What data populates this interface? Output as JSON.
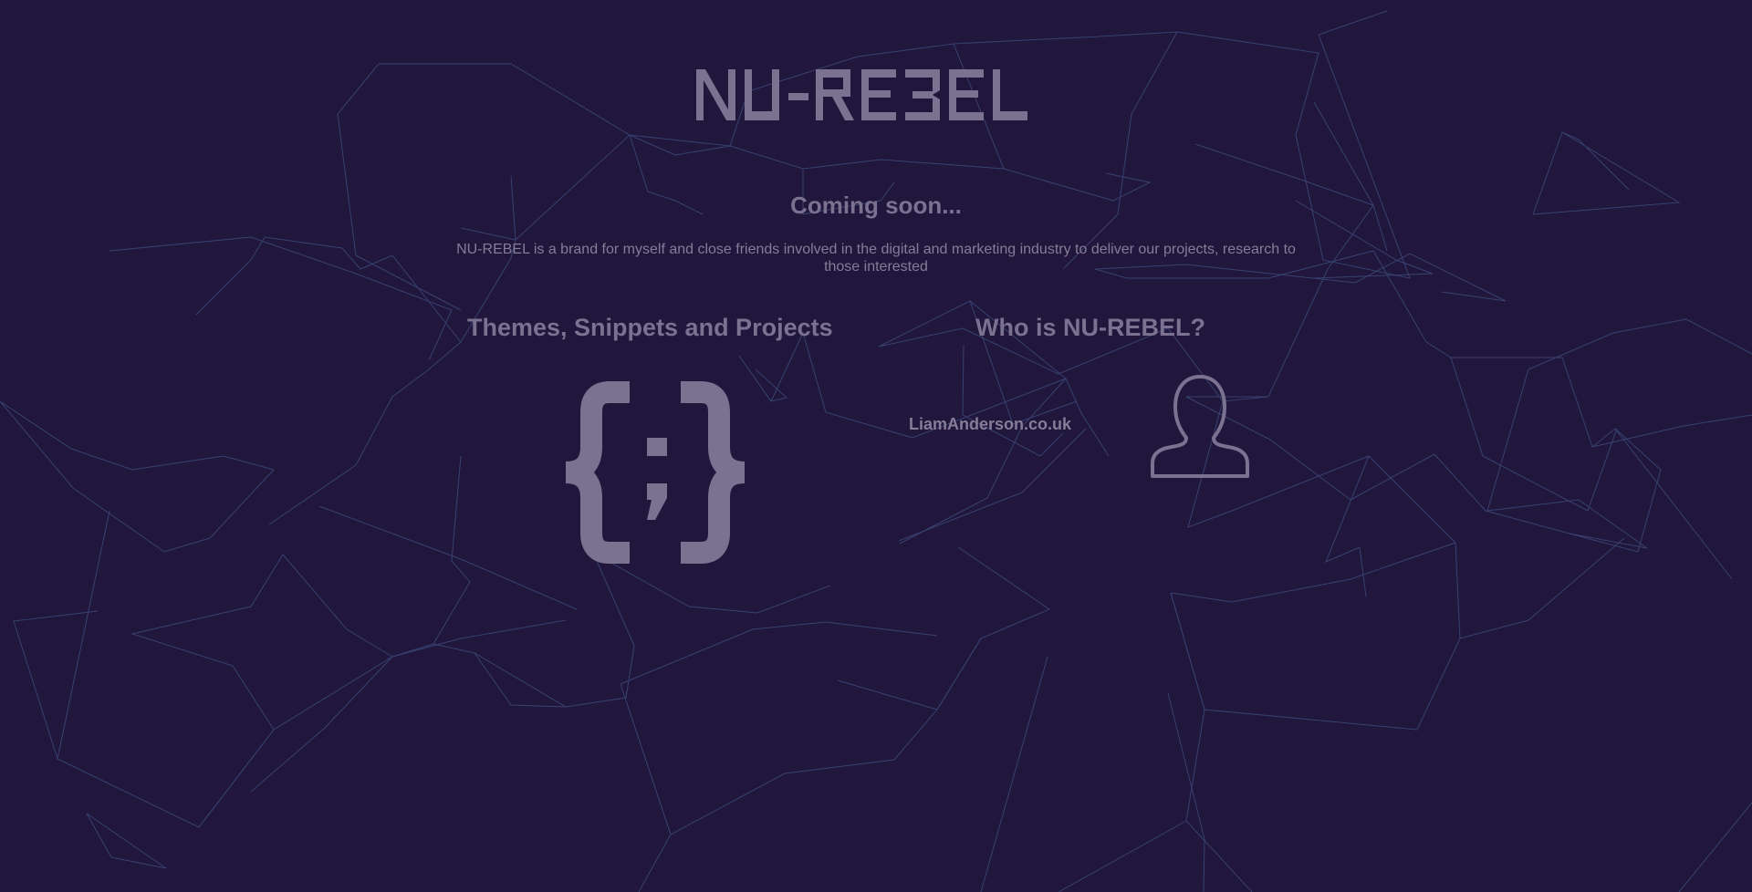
{
  "brand": {
    "logo_text": "NU-REBEL"
  },
  "hero": {
    "heading": "Coming soon...",
    "description": "NU-REBEL is a brand for myself and close friends involved in the digital and marketing industry to deliver our projects, research to those interested"
  },
  "sections": {
    "projects": {
      "title": "Themes, Snippets and Projects",
      "icon": "code-braces-icon"
    },
    "about": {
      "title": "Who is NU-REBEL?",
      "link_text": "LiamAnderson.co.uk",
      "icon": "person-silhouette-icon"
    }
  },
  "colors": {
    "background": "#21163b",
    "text": "#7b7191",
    "network_lines": "#3b4a7a"
  }
}
